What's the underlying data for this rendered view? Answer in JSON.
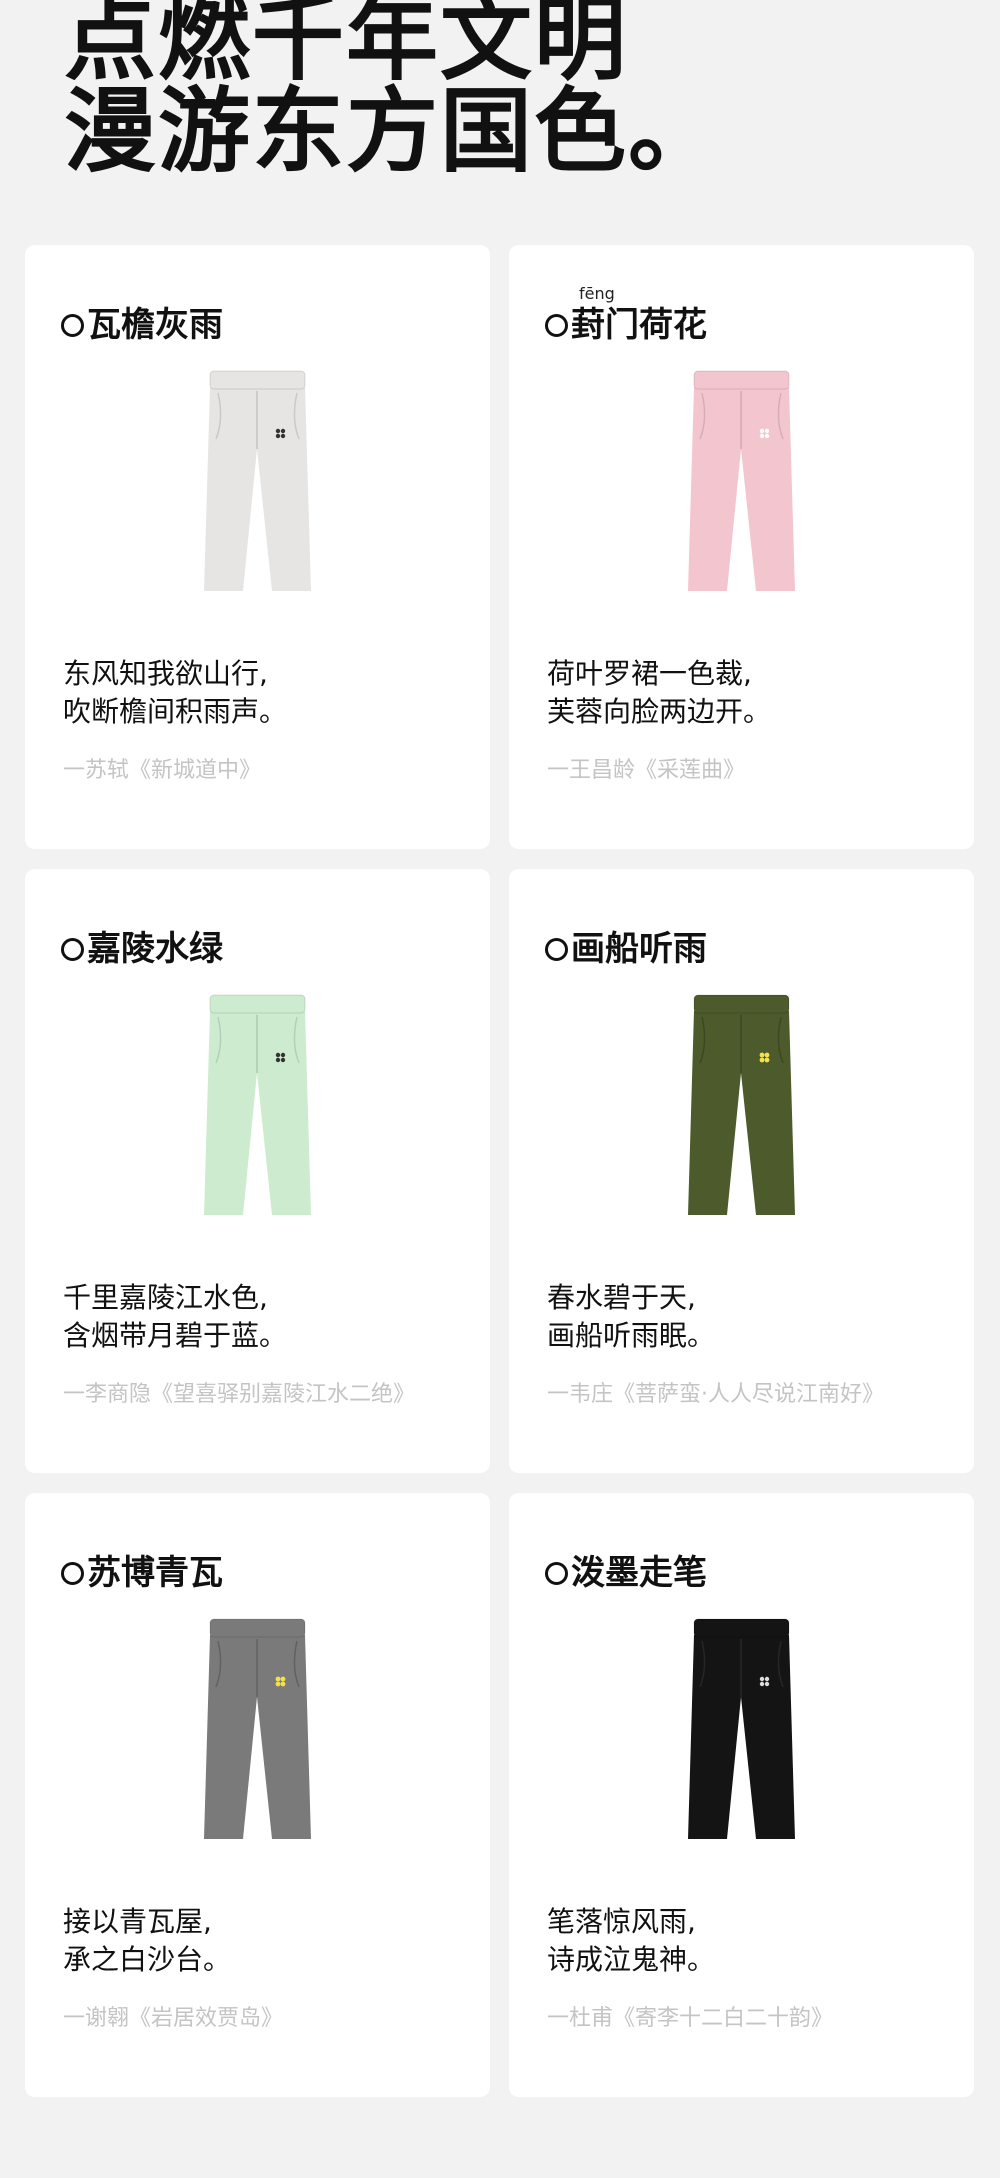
{
  "headline": {
    "line1": "点燃千年文明",
    "line2": "漫游东方国色。"
  },
  "cards": [
    {
      "title": "瓦檐灰雨",
      "pinyin": "",
      "pants_color": "#e6e5e3",
      "poem_line1": "东风知我欲山行,",
      "poem_line2": "吹断檐间积雨声。",
      "source": "一苏轼《新城道中》"
    },
    {
      "title": "葑门荷花",
      "pinyin": "fēng",
      "pants_color": "#f3c6cf",
      "poem_line1": "荷叶罗裙一色裁,",
      "poem_line2": "芙蓉向脸两边开。",
      "source": "一王昌龄《采莲曲》"
    },
    {
      "title": "嘉陵水绿",
      "pinyin": "",
      "pants_color": "#cdeccf",
      "poem_line1": "千里嘉陵江水色,",
      "poem_line2": "含烟带月碧于蓝。",
      "source": "一李商隐《望喜驿别嘉陵江水二绝》"
    },
    {
      "title": "画船听雨",
      "pinyin": "",
      "pants_color": "#4c5a2c",
      "poem_line1": "春水碧于天,",
      "poem_line2": "画船听雨眠。",
      "source": "一韦庄《菩萨蛮·人人尽说江南好》"
    },
    {
      "title": "苏博青瓦",
      "pinyin": "",
      "pants_color": "#7a7a7a",
      "poem_line1": "接以青瓦屋,",
      "poem_line2": "承之白沙台。",
      "source": "一谢翱《岩居效贾岛》"
    },
    {
      "title": "泼墨走笔",
      "pinyin": "",
      "pants_color": "#141414",
      "poem_line1": "笔落惊风雨,",
      "poem_line2": "诗成泣鬼神。",
      "source": "一杜甫《寄李十二白二十韵》"
    }
  ]
}
